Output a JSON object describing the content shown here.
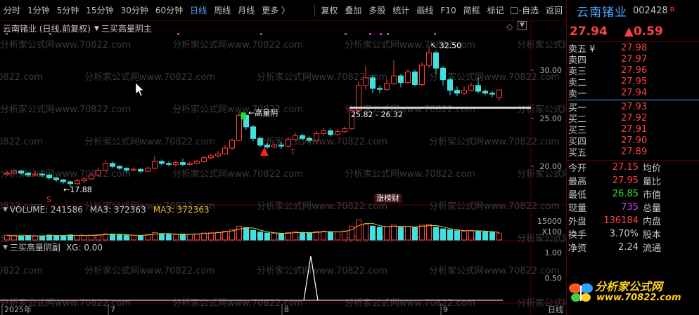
{
  "toolbar": {
    "left": [
      "分时",
      "1分钟",
      "5分钟",
      "15分钟",
      "30分钟",
      "60分钟",
      "日线",
      "周线",
      "月线",
      "更多 〉"
    ],
    "active": "日线",
    "right": [
      "复权",
      "叠加",
      "多股",
      "统计",
      "画线",
      "F10",
      "简框",
      "标记"
    ],
    "self_select": "-自选",
    "back": "返回"
  },
  "chart": {
    "header_title": "云南锗业 (日线,前复权)",
    "indicator_name": "三买高量阴主",
    "watermark": "分析家公式网www.70822.com",
    "annotations": {
      "high": "32.50",
      "low": "17.88",
      "high_vol_bear": "高量阴",
      "range": "25.82 - 26.32",
      "badge": "涨榜财",
      "s_mark": "S"
    },
    "price_axis": [
      "30.00",
      "25.00",
      "20.00"
    ],
    "volume_header": {
      "label": "VOLUME: 241586",
      "ma_a": "MA3: 372363",
      "ma_b": "MA3: 372363"
    },
    "volume_axis": [
      "15000",
      "X100"
    ],
    "sub_header": {
      "name": "三买高量阴副",
      "xg": "XG: 0.00"
    },
    "sub_axis": [
      "1.00",
      "0.50"
    ],
    "x_labels": [
      "2025年",
      "7",
      "8",
      "9"
    ],
    "x_right": "日线"
  },
  "chart_data": {
    "type": "candlestick",
    "title": "云南锗业 (日线,前复权)",
    "ylim": [
      16,
      34
    ],
    "candles": [
      {
        "o": 19.2,
        "c": 19.3,
        "h": 19.5,
        "l": 19.0
      },
      {
        "o": 19.3,
        "c": 19.5,
        "h": 19.7,
        "l": 19.2
      },
      {
        "o": 19.5,
        "c": 19.3,
        "h": 19.6,
        "l": 19.1
      },
      {
        "o": 19.3,
        "c": 19.1,
        "h": 19.4,
        "l": 18.9
      },
      {
        "o": 19.1,
        "c": 19.2,
        "h": 19.5,
        "l": 19.0
      },
      {
        "o": 19.2,
        "c": 19.1,
        "h": 19.3,
        "l": 18.9
      },
      {
        "o": 19.1,
        "c": 18.8,
        "h": 19.2,
        "l": 18.6
      },
      {
        "o": 18.8,
        "c": 18.6,
        "h": 18.9,
        "l": 18.4
      },
      {
        "o": 18.6,
        "c": 18.4,
        "h": 18.7,
        "l": 18.2
      },
      {
        "o": 18.4,
        "c": 18.2,
        "h": 18.5,
        "l": 17.88
      },
      {
        "o": 18.2,
        "c": 18.5,
        "h": 18.7,
        "l": 18.1
      },
      {
        "o": 18.5,
        "c": 18.7,
        "h": 18.9,
        "l": 18.3
      },
      {
        "o": 18.7,
        "c": 19.1,
        "h": 19.3,
        "l": 18.6
      },
      {
        "o": 19.1,
        "c": 19.6,
        "h": 19.9,
        "l": 19.0
      },
      {
        "o": 19.6,
        "c": 20.3,
        "h": 20.6,
        "l": 19.5
      },
      {
        "o": 20.3,
        "c": 20.0,
        "h": 20.5,
        "l": 19.8
      },
      {
        "o": 20.0,
        "c": 19.8,
        "h": 20.1,
        "l": 19.6
      },
      {
        "o": 19.8,
        "c": 19.6,
        "h": 19.9,
        "l": 19.4
      },
      {
        "o": 19.6,
        "c": 19.7,
        "h": 19.9,
        "l": 19.5
      },
      {
        "o": 19.7,
        "c": 19.5,
        "h": 19.8,
        "l": 19.3
      },
      {
        "o": 19.5,
        "c": 19.8,
        "h": 20.0,
        "l": 19.4
      },
      {
        "o": 19.8,
        "c": 20.5,
        "h": 21.1,
        "l": 19.7
      },
      {
        "o": 20.5,
        "c": 20.3,
        "h": 20.7,
        "l": 20.1
      },
      {
        "o": 20.3,
        "c": 20.2,
        "h": 20.5,
        "l": 20.0
      },
      {
        "o": 20.2,
        "c": 20.4,
        "h": 20.6,
        "l": 20.0
      },
      {
        "o": 20.4,
        "c": 20.2,
        "h": 20.8,
        "l": 20.0
      },
      {
        "o": 20.2,
        "c": 20.3,
        "h": 20.5,
        "l": 20.1
      },
      {
        "o": 20.3,
        "c": 20.5,
        "h": 20.7,
        "l": 20.2
      },
      {
        "o": 20.5,
        "c": 20.9,
        "h": 21.1,
        "l": 20.4
      },
      {
        "o": 20.9,
        "c": 21.1,
        "h": 21.3,
        "l": 20.7
      },
      {
        "o": 21.1,
        "c": 21.3,
        "h": 21.6,
        "l": 20.9
      },
      {
        "o": 21.3,
        "c": 21.9,
        "h": 22.2,
        "l": 21.2
      },
      {
        "o": 21.9,
        "c": 22.7,
        "h": 22.9,
        "l": 21.7
      },
      {
        "o": 22.7,
        "c": 25.3,
        "h": 25.6,
        "l": 22.6
      },
      {
        "o": 25.3,
        "c": 24.1,
        "h": 25.4,
        "l": 23.8
      },
      {
        "o": 24.1,
        "c": 22.9,
        "h": 24.3,
        "l": 22.6
      },
      {
        "o": 22.9,
        "c": 22.2,
        "h": 23.1,
        "l": 22.0
      },
      {
        "o": 22.2,
        "c": 22.0,
        "h": 22.4,
        "l": 21.8
      },
      {
        "o": 22.0,
        "c": 22.2,
        "h": 22.4,
        "l": 21.9
      },
      {
        "o": 22.2,
        "c": 22.1,
        "h": 22.5,
        "l": 21.8
      },
      {
        "o": 22.1,
        "c": 22.8,
        "h": 23.0,
        "l": 22.0
      },
      {
        "o": 22.8,
        "c": 23.2,
        "h": 23.5,
        "l": 22.7
      },
      {
        "o": 23.2,
        "c": 22.9,
        "h": 23.4,
        "l": 22.7
      },
      {
        "o": 22.9,
        "c": 22.7,
        "h": 23.1,
        "l": 22.5
      },
      {
        "o": 22.7,
        "c": 23.4,
        "h": 23.7,
        "l": 22.6
      },
      {
        "o": 23.4,
        "c": 23.7,
        "h": 24.0,
        "l": 23.2
      },
      {
        "o": 23.7,
        "c": 23.3,
        "h": 23.9,
        "l": 23.1
      },
      {
        "o": 23.3,
        "c": 23.6,
        "h": 23.9,
        "l": 23.2
      },
      {
        "o": 23.6,
        "c": 23.9,
        "h": 24.1,
        "l": 23.5
      },
      {
        "o": 23.9,
        "c": 25.82,
        "h": 26.2,
        "l": 23.8
      },
      {
        "o": 25.82,
        "c": 28.4,
        "h": 28.8,
        "l": 25.7
      },
      {
        "o": 28.4,
        "c": 29.2,
        "h": 30.4,
        "l": 28.0
      },
      {
        "o": 29.2,
        "c": 28.1,
        "h": 29.5,
        "l": 27.6
      },
      {
        "o": 28.1,
        "c": 28.0,
        "h": 28.4,
        "l": 27.6
      },
      {
        "o": 28.0,
        "c": 28.6,
        "h": 29.0,
        "l": 27.9
      },
      {
        "o": 28.6,
        "c": 29.4,
        "h": 31.0,
        "l": 28.4
      },
      {
        "o": 29.4,
        "c": 28.7,
        "h": 29.6,
        "l": 28.2
      },
      {
        "o": 28.7,
        "c": 29.8,
        "h": 30.1,
        "l": 28.6
      },
      {
        "o": 29.8,
        "c": 28.5,
        "h": 30.0,
        "l": 28.3
      },
      {
        "o": 28.5,
        "c": 30.5,
        "h": 30.8,
        "l": 28.3
      },
      {
        "o": 30.5,
        "c": 31.8,
        "h": 32.5,
        "l": 30.2
      },
      {
        "o": 31.8,
        "c": 30.2,
        "h": 32.0,
        "l": 29.6
      },
      {
        "o": 30.2,
        "c": 29.0,
        "h": 30.4,
        "l": 28.4
      },
      {
        "o": 29.0,
        "c": 27.9,
        "h": 29.2,
        "l": 27.4
      },
      {
        "o": 27.9,
        "c": 27.6,
        "h": 28.3,
        "l": 27.3
      },
      {
        "o": 27.6,
        "c": 27.9,
        "h": 28.3,
        "l": 27.4
      },
      {
        "o": 27.9,
        "c": 28.4,
        "h": 28.7,
        "l": 27.8
      },
      {
        "o": 28.4,
        "c": 27.8,
        "h": 29.2,
        "l": 27.6
      },
      {
        "o": 27.8,
        "c": 27.6,
        "h": 28.0,
        "l": 27.4
      },
      {
        "o": 27.6,
        "c": 27.5,
        "h": 27.8,
        "l": 27.2
      },
      {
        "o": 27.15,
        "c": 27.94,
        "h": 27.95,
        "l": 26.85
      }
    ],
    "volume": [
      180,
      150,
      160,
      170,
      140,
      150,
      180,
      170,
      160,
      190,
      170,
      160,
      180,
      200,
      230,
      220,
      190,
      170,
      180,
      170,
      200,
      280,
      240,
      210,
      200,
      220,
      210,
      230,
      260,
      270,
      290,
      330,
      380,
      520,
      470,
      360,
      300,
      260,
      250,
      240,
      280,
      300,
      270,
      260,
      320,
      330,
      290,
      300,
      340,
      520,
      760,
      600,
      520,
      480,
      500,
      560,
      480,
      510,
      470,
      560,
      590,
      480,
      420,
      380,
      350,
      330,
      360,
      340,
      310,
      290,
      241
    ],
    "ma3": [
      170,
      165,
      160,
      160,
      155,
      150,
      155,
      165,
      170,
      175,
      175,
      170,
      170,
      180,
      205,
      215,
      215,
      195,
      180,
      175,
      185,
      215,
      240,
      245,
      215,
      210,
      210,
      220,
      235,
      255,
      275,
      300,
      335,
      410,
      455,
      450,
      375,
      305,
      270,
      250,
      255,
      275,
      285,
      275,
      285,
      305,
      315,
      305,
      310,
      385,
      540,
      625,
      625,
      535,
      500,
      515,
      515,
      515,
      485,
      515,
      540,
      545,
      495,
      425,
      385,
      355,
      345,
      345,
      335,
      315,
      280
    ],
    "signal_index": 54
  },
  "panel": {
    "name": "云南锗业",
    "code": "002428",
    "r_mark": "R",
    "price": "27.94",
    "change": "▲0.59",
    "asks": [
      {
        "label": "卖五 ¥",
        "value": "27.98"
      },
      {
        "label": "卖四",
        "value": "27.97"
      },
      {
        "label": "卖三",
        "value": "27.96"
      },
      {
        "label": "卖二",
        "value": "27.95"
      },
      {
        "label": "卖一",
        "value": "27.94"
      }
    ],
    "bids": [
      {
        "label": "买一",
        "value": "27.93"
      },
      {
        "label": "买二",
        "value": "27.92"
      },
      {
        "label": "买三",
        "value": "27.91"
      },
      {
        "label": "买四",
        "value": "27.90"
      },
      {
        "label": "买五",
        "value": "27.89"
      }
    ],
    "stats": [
      {
        "k": "今开",
        "v": "27.15",
        "vcolor": "#ff4040",
        "k2": "均价"
      },
      {
        "k": "最高",
        "v": "27.95",
        "vcolor": "#ff4040",
        "k2": "量比"
      },
      {
        "k": "最低",
        "v": "26.85",
        "vcolor": "#2fe02f",
        "k2": "市值"
      },
      {
        "k": "现量",
        "v": "735",
        "vcolor": "#d040ff",
        "k2": "总量"
      },
      {
        "k": "外盘",
        "v": "136184",
        "vcolor": "#ff4040",
        "k2": "内盘"
      },
      {
        "k": "换手",
        "v": "3.70%",
        "vcolor": "#c8c8c8",
        "k2": "股本"
      },
      {
        "k": "净资",
        "v": "2.24",
        "vcolor": "#c8c8c8",
        "k2": "流通"
      }
    ],
    "logo_main": "分析家公式网",
    "logo_sub": "www.70822.com"
  },
  "colors": {
    "up": "#ff3b3b",
    "down": "#3fe0e0",
    "ma": "#e0c030",
    "accent": "#4da3ff"
  }
}
